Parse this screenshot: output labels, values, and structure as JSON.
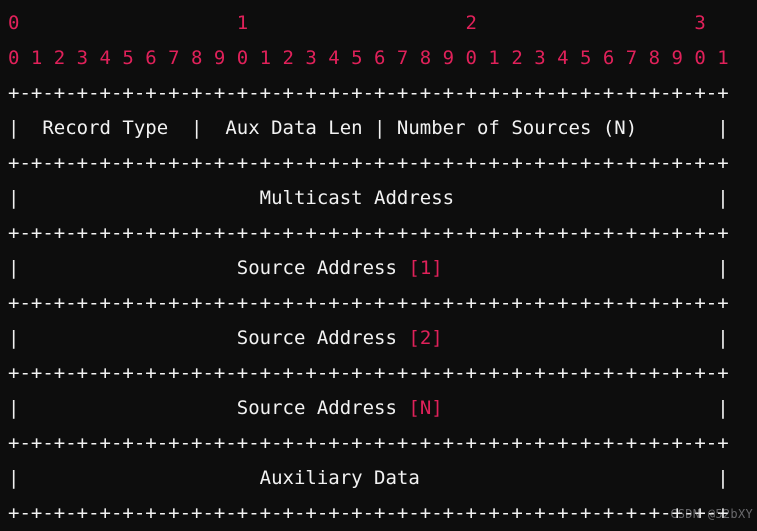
{
  "theme": {
    "background": "#0d0d0d",
    "text_color": "#f2f2f2",
    "ruler_color": "#e0215a",
    "index_color": "#e0215a",
    "watermark_color": "#bebec3"
  },
  "ruler": {
    "tens_row": "0                   1                   2                   3",
    "units_row": "0 1 2 3 4 5 6 7 8 9 0 1 2 3 4 5 6 7 8 9 0 1 2 3 4 5 6 7 8 9 0 1",
    "bit_width": 32,
    "tens_labels": [
      "0",
      "1",
      "2",
      "3"
    ],
    "unit_labels": [
      "0",
      "1",
      "2",
      "3",
      "4",
      "5",
      "6",
      "7",
      "8",
      "9",
      "0",
      "1",
      "2",
      "3",
      "4",
      "5",
      "6",
      "7",
      "8",
      "9",
      "0",
      "1",
      "2",
      "3",
      "4",
      "5",
      "6",
      "7",
      "8",
      "9",
      "0",
      "1"
    ]
  },
  "separator": "+-+-+-+-+-+-+-+-+-+-+-+-+-+-+-+-+-+-+-+-+-+-+-+-+-+-+-+-+-+-+-+",
  "rows": [
    {
      "name": "record-header-row",
      "cells": [
        {
          "label": "Record Type",
          "bits": 8,
          "pad_left": 2,
          "pad_right": 2
        },
        {
          "label": "Aux Data Len",
          "bits": 8,
          "pad_left": 2,
          "pad_right": 1
        },
        {
          "label": "Number of Sources (N)",
          "bits": 16,
          "pad_left": 7,
          "pad_right": 5
        }
      ],
      "text": "|  Record Type  |  Aux Data Len | Number of Sources (N)       |"
    },
    {
      "name": "multicast-address-row",
      "label": "Multicast Address",
      "text": "|                     Multicast Address                       |"
    },
    {
      "name": "source-address-1-row",
      "label": "Source Address ",
      "index": "[1]",
      "text": "|                   Source Address [1]                        |"
    },
    {
      "name": "source-address-2-row",
      "label": "Source Address ",
      "index": "[2]",
      "text": "|                   Source Address [2]                        |"
    },
    {
      "name": "source-address-n-row",
      "label": "Source Address ",
      "index": "[N]",
      "text": "|                   Source Address [N]                        |"
    },
    {
      "name": "auxiliary-data-row",
      "label": "Auxiliary Data",
      "text": "|                     Auxiliary Data                          |"
    }
  ],
  "watermark": {
    "text": "CSDN @52bXY"
  }
}
